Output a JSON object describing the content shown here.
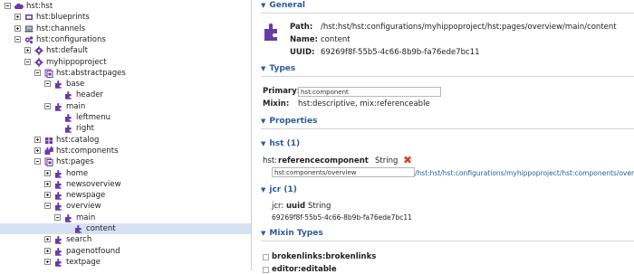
{
  "tree": [
    {
      "label": "hst:hst",
      "toggle": "minus",
      "icon": "cloud-icon"
    },
    {
      "label": "hst:blueprints",
      "toggle": "plus",
      "icon": "blueprint-icon"
    },
    {
      "label": "hst:channels",
      "toggle": "plus",
      "icon": "channel-icon"
    },
    {
      "label": "hst:configurations",
      "toggle": "minus",
      "icon": "config-icon"
    },
    {
      "label": "hst:default",
      "toggle": "plus",
      "icon": "gear-icon"
    },
    {
      "label": "myhippoproject",
      "toggle": "minus",
      "icon": "gear-icon"
    },
    {
      "label": "hst:abstractpages",
      "toggle": "minus",
      "icon": "pages-icon"
    },
    {
      "label": "base",
      "toggle": "minus",
      "icon": "component-icon"
    },
    {
      "label": "header",
      "toggle": "none",
      "icon": "component-icon"
    },
    {
      "label": "main",
      "toggle": "minus",
      "icon": "component-icon"
    },
    {
      "label": "leftmenu",
      "toggle": "none",
      "icon": "component-icon"
    },
    {
      "label": "right",
      "toggle": "none",
      "icon": "component-icon"
    },
    {
      "label": "hst:catalog",
      "toggle": "plus",
      "icon": "catalog-icon"
    },
    {
      "label": "hst:components",
      "toggle": "plus",
      "icon": "components-icon"
    },
    {
      "label": "hst:pages",
      "toggle": "minus",
      "icon": "pages-icon"
    },
    {
      "label": "home",
      "toggle": "plus",
      "icon": "component-icon"
    },
    {
      "label": "newsoverview",
      "toggle": "plus",
      "icon": "component-icon"
    },
    {
      "label": "newspage",
      "toggle": "plus",
      "icon": "component-icon"
    },
    {
      "label": "overview",
      "toggle": "minus",
      "icon": "component-icon"
    },
    {
      "label": "main",
      "toggle": "minus",
      "icon": "component-icon"
    },
    {
      "label": "content",
      "toggle": "none",
      "icon": "component-icon"
    },
    {
      "label": "search",
      "toggle": "plus",
      "icon": "component-icon"
    },
    {
      "label": "pagenotfound",
      "toggle": "plus",
      "icon": "component-icon"
    },
    {
      "label": "textpage",
      "toggle": "plus",
      "icon": "component-icon"
    }
  ],
  "general": {
    "title": "General",
    "path_label": "Path:",
    "path": "/hst:hst/hst:configurations/myhippoproject/hst:pages/overview/main/content",
    "name_label": "Name:",
    "name": "content",
    "uuid_label": "UUID:",
    "uuid": "69269f8f-55b5-4c66-8b9b-fa76ede7bc11"
  },
  "types": {
    "title": "Types",
    "primary_label": "Primary:",
    "primary_value": "hst:component",
    "mixin_label": "Mixin:",
    "mixin_value": "hst:descriptive, mix:referenceable"
  },
  "properties": {
    "title": "Properties",
    "hst_group": "hst (1)",
    "hst_prop_prefix": "hst:",
    "hst_prop_name": "referencecomponent",
    "hst_prop_type": "String",
    "hst_prop_value": "hst:components/overview",
    "hst_prop_link": "/hst:hst/hst:configurations/myhippoproject/hst:components/overview",
    "jcr_group": "jcr (1)",
    "jcr_prop_prefix": "jcr:",
    "jcr_prop_name": "uuid",
    "jcr_prop_type": "String",
    "jcr_prop_value": "69269f8f-55b5-4c66-8b9b-fa76ede7bc11"
  },
  "mixin_types": {
    "title": "Mixin Types",
    "items": [
      "brokenlinks:brokenlinks",
      "editor:editable"
    ]
  },
  "colors": {
    "accent": "#2b5b9c",
    "icon_purple": "#6a3aa8",
    "delete_red": "#d9412b",
    "selected_row": "#d6e1f2"
  }
}
